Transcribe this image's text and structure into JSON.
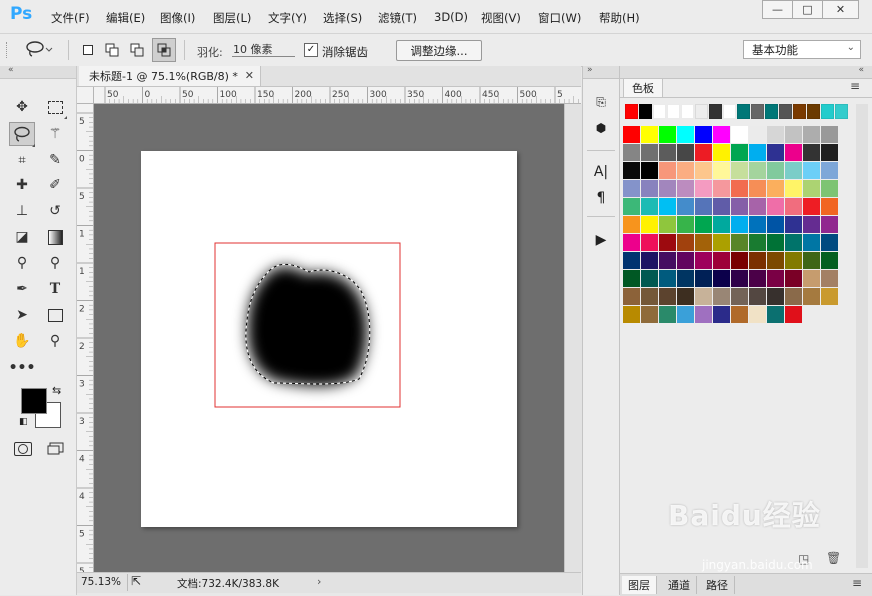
{
  "app": {
    "logo": "Ps"
  },
  "menu": [
    "文件(F)",
    "编辑(E)",
    "图像(I)",
    "图层(L)",
    "文字(Y)",
    "选择(S)",
    "滤镜(T)",
    "3D(D)",
    "视图(V)",
    "窗口(W)",
    "帮助(H)"
  ],
  "window_controls": {
    "minimize": "—",
    "maximize": "□",
    "close": "✕"
  },
  "options": {
    "feather_label": "羽化:",
    "feather_value": "10 像素",
    "antialias_checked": "✓",
    "antialias_label": "消除锯齿",
    "refine_edge_button": "调整边缘...",
    "workspace": "基本功能"
  },
  "document": {
    "tab_title": "未标题-1 @ 75.1%(RGB/8) *",
    "tab_close": "✕",
    "zoom": "75.13%",
    "doc_info": "文档:732.4K/383.8K",
    "ruler_top_labels": [
      "50",
      "0",
      "50",
      "100",
      "150",
      "200",
      "250",
      "300",
      "350",
      "400",
      "450",
      "500",
      "5"
    ],
    "ruler_left_labels": [
      "5",
      "0",
      "5",
      "1",
      "1",
      "2",
      "2",
      "3",
      "3",
      "4",
      "4",
      "5",
      "5"
    ]
  },
  "panel": {
    "tab_title": "色板",
    "bottom_tabs": [
      "图层",
      "通道",
      "路径"
    ],
    "recent_swatches": [
      "#ff0000",
      "#000000",
      "#ffffff",
      "#ffffff",
      "#ffffff",
      "#ededed",
      "#333333",
      "#ffffff",
      "#007777",
      "#666666",
      "#007777",
      "#555555",
      "#7a3a00",
      "#6b3a00",
      "#22cccc",
      "#33cccc"
    ],
    "swatches": [
      "#ff0000",
      "#ffff00",
      "#00ff00",
      "#00ffff",
      "#0000ff",
      "#ff00ff",
      "#ffffff",
      "#ebebeb",
      "#d6d6d6",
      "#c2c2c2",
      "#adadad",
      "#999999",
      "#858585",
      "#707070",
      "#5c5c5c",
      "#474747",
      "#ed1c24",
      "#fff200",
      "#00a651",
      "#00aeef",
      "#2e3192",
      "#ec008c",
      "#333333",
      "#1f1f1f",
      "#0a0a0a",
      "#000000",
      "#f7977a",
      "#fbad82",
      "#fdc68c",
      "#fff799",
      "#c6df9c",
      "#a4d49d",
      "#81ca9d",
      "#7bcdc8",
      "#6ccff7",
      "#7ea7d8",
      "#8493ca",
      "#8882be",
      "#a286bd",
      "#bc8cbf",
      "#f49bc1",
      "#f5989d",
      "#f26c4f",
      "#f68e56",
      "#fbaf5d",
      "#fff467",
      "#acd372",
      "#7dc473",
      "#3cb878",
      "#1cbbb4",
      "#00bff3",
      "#448ccb",
      "#5574b9",
      "#605ca8",
      "#855fa8",
      "#a763a9",
      "#ef6ea8",
      "#f16d7e",
      "#ee1d24",
      "#f16522",
      "#f7941d",
      "#fff100",
      "#8fc63d",
      "#37b44a",
      "#00a650",
      "#00a99e",
      "#00aeef",
      "#0072bc",
      "#0054a5",
      "#2f3192",
      "#652c91",
      "#91278f",
      "#ed008c",
      "#ee105a",
      "#9d0a0f",
      "#a1410d",
      "#a36209",
      "#aba000",
      "#588528",
      "#197b30",
      "#007236",
      "#00736a",
      "#0076a4",
      "#004a80",
      "#003370",
      "#1d1363",
      "#450e61",
      "#62055f",
      "#9e005c",
      "#9d0039",
      "#790000",
      "#7b3000",
      "#7c4900",
      "#827a00",
      "#3e6617",
      "#045f20",
      "#005824",
      "#005951",
      "#005b7e",
      "#003562",
      "#002056",
      "#0c004b",
      "#30004a",
      "#4b0048",
      "#7a0045",
      "#7a0026",
      "#c69c6e",
      "#a38064",
      "#8c6239",
      "#745838",
      "#5c432e",
      "#3d2e20",
      "#c7b299",
      "#998675",
      "#736357",
      "#534741",
      "#37302d",
      "#8a6a4a",
      "#a57a3f",
      "#c99a2e",
      "#b88a00",
      "#8f6b3a",
      "#2a8a6a",
      "#3aa0d9",
      "#9f70c0",
      "#2b2b8a",
      "#b06a2a",
      "#f1e2c6",
      "#0b7070",
      "#e0101a"
    ]
  },
  "watermark": {
    "text": "Baidu经验",
    "url": "jingyan.baidu.com"
  }
}
